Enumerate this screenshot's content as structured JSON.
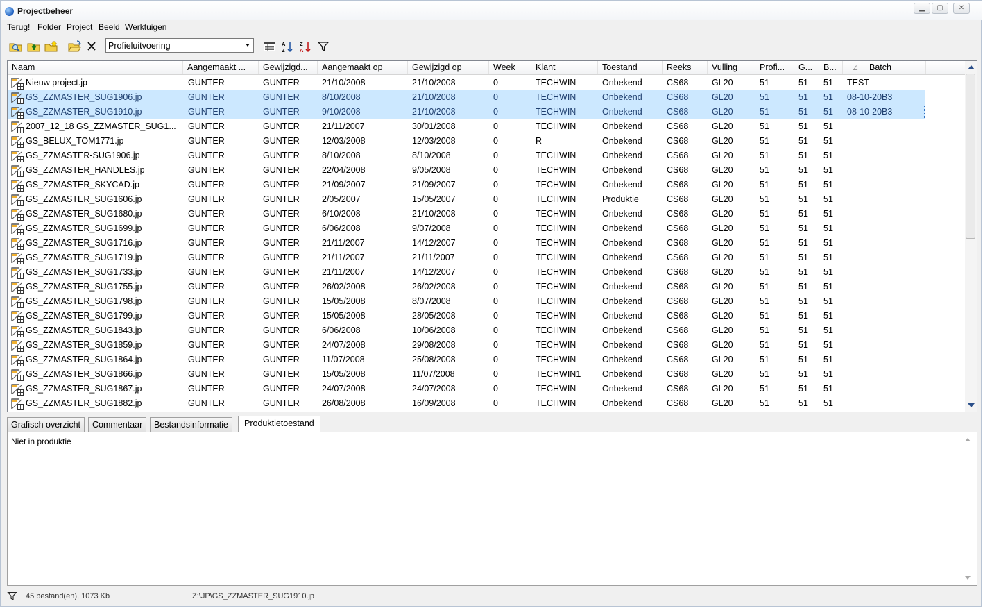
{
  "window": {
    "title": "Projectbeheer"
  },
  "menu": [
    "Terug!",
    "Folder",
    "Project",
    "Beeld",
    "Werktuigen"
  ],
  "toolbar": {
    "left_icons": [
      "search-folder-icon",
      "folder-up-icon",
      "new-folder-icon",
      "open-folder-icon",
      "delete-icon"
    ],
    "profile_select": {
      "value": "Profieluitvoering"
    },
    "right_icons": [
      "details-view-icon",
      "sort-ascending-icon",
      "sort-descending-icon",
      "filter-icon"
    ]
  },
  "columns": [
    "Naam",
    "Aangemaakt ...",
    "Gewijzigd...",
    "Aangemaakt op",
    "Gewijzigd op",
    "Week",
    "Klant",
    "Toestand",
    "Reeks",
    "Vulling",
    "Profi...",
    "G...",
    "B...",
    "Batch"
  ],
  "rows": [
    {
      "name": "Nieuw project.jp",
      "created_by": "GUNTER",
      "modified_by": "GUNTER",
      "created_on": "21/10/2008",
      "modified_on": "21/10/2008",
      "week": "0",
      "client": "TECHWIN",
      "state": "Onbekend",
      "series": "CS68",
      "filling": "GL20",
      "profile": "51",
      "g": "51",
      "b": "51",
      "batch": "TEST"
    },
    {
      "name": "GS_ZZMASTER_SUG1906.jp",
      "created_by": "GUNTER",
      "modified_by": "GUNTER",
      "created_on": "8/10/2008",
      "modified_on": "21/10/2008",
      "week": "0",
      "client": "TECHWIN",
      "state": "Onbekend",
      "series": "CS68",
      "filling": "GL20",
      "profile": "51",
      "g": "51",
      "b": "51",
      "batch": "08-10-20B3",
      "selected": true
    },
    {
      "name": "GS_ZZMASTER_SUG1910.jp",
      "created_by": "GUNTER",
      "modified_by": "GUNTER",
      "created_on": "9/10/2008",
      "modified_on": "21/10/2008",
      "week": "0",
      "client": "TECHWIN",
      "state": "Onbekend",
      "series": "CS68",
      "filling": "GL20",
      "profile": "51",
      "g": "51",
      "b": "51",
      "batch": "08-10-20B3",
      "selected": true,
      "focused": true
    },
    {
      "name": "2007_12_18 GS_ZZMASTER_SUG1...",
      "created_by": "GUNTER",
      "modified_by": "GUNTER",
      "created_on": "21/11/2007",
      "modified_on": "30/01/2008",
      "week": "0",
      "client": "TECHWIN",
      "state": "Onbekend",
      "series": "CS68",
      "filling": "GL20",
      "profile": "51",
      "g": "51",
      "b": "51",
      "batch": ""
    },
    {
      "name": "GS_BELUX_TOM1771.jp",
      "created_by": "GUNTER",
      "modified_by": "GUNTER",
      "created_on": "12/03/2008",
      "modified_on": "12/03/2008",
      "week": "0",
      "client": "R",
      "state": "Onbekend",
      "series": "CS68",
      "filling": "GL20",
      "profile": "51",
      "g": "51",
      "b": "51",
      "batch": ""
    },
    {
      "name": "GS_ZZMASTER-SUG1906.jp",
      "created_by": "GUNTER",
      "modified_by": "GUNTER",
      "created_on": "8/10/2008",
      "modified_on": "8/10/2008",
      "week": "0",
      "client": "TECHWIN",
      "state": "Onbekend",
      "series": "CS68",
      "filling": "GL20",
      "profile": "51",
      "g": "51",
      "b": "51",
      "batch": ""
    },
    {
      "name": "GS_ZZMASTER_HANDLES.jp",
      "created_by": "GUNTER",
      "modified_by": "GUNTER",
      "created_on": "22/04/2008",
      "modified_on": "9/05/2008",
      "week": "0",
      "client": "TECHWIN",
      "state": "Onbekend",
      "series": "CS68",
      "filling": "GL20",
      "profile": "51",
      "g": "51",
      "b": "51",
      "batch": ""
    },
    {
      "name": "GS_ZZMASTER_SKYCAD.jp",
      "created_by": "GUNTER",
      "modified_by": "GUNTER",
      "created_on": "21/09/2007",
      "modified_on": "21/09/2007",
      "week": "0",
      "client": "TECHWIN",
      "state": "Onbekend",
      "series": "CS68",
      "filling": "GL20",
      "profile": "51",
      "g": "51",
      "b": "51",
      "batch": ""
    },
    {
      "name": "GS_ZZMASTER_SUG1606.jp",
      "created_by": "GUNTER",
      "modified_by": "GUNTER",
      "created_on": "2/05/2007",
      "modified_on": "15/05/2007",
      "week": "0",
      "client": "TECHWIN",
      "state": "Produktie",
      "series": "CS68",
      "filling": "GL20",
      "profile": "51",
      "g": "51",
      "b": "51",
      "batch": ""
    },
    {
      "name": "GS_ZZMASTER_SUG1680.jp",
      "created_by": "GUNTER",
      "modified_by": "GUNTER",
      "created_on": "6/10/2008",
      "modified_on": "21/10/2008",
      "week": "0",
      "client": "TECHWIN",
      "state": "Onbekend",
      "series": "CS68",
      "filling": "GL20",
      "profile": "51",
      "g": "51",
      "b": "51",
      "batch": ""
    },
    {
      "name": "GS_ZZMASTER_SUG1699.jp",
      "created_by": "GUNTER",
      "modified_by": "GUNTER",
      "created_on": "6/06/2008",
      "modified_on": "9/07/2008",
      "week": "0",
      "client": "TECHWIN",
      "state": "Onbekend",
      "series": "CS68",
      "filling": "GL20",
      "profile": "51",
      "g": "51",
      "b": "51",
      "batch": ""
    },
    {
      "name": "GS_ZZMASTER_SUG1716.jp",
      "created_by": "GUNTER",
      "modified_by": "GUNTER",
      "created_on": "21/11/2007",
      "modified_on": "14/12/2007",
      "week": "0",
      "client": "TECHWIN",
      "state": "Onbekend",
      "series": "CS68",
      "filling": "GL20",
      "profile": "51",
      "g": "51",
      "b": "51",
      "batch": ""
    },
    {
      "name": "GS_ZZMASTER_SUG1719.jp",
      "created_by": "GUNTER",
      "modified_by": "GUNTER",
      "created_on": "21/11/2007",
      "modified_on": "21/11/2007",
      "week": "0",
      "client": "TECHWIN",
      "state": "Onbekend",
      "series": "CS68",
      "filling": "GL20",
      "profile": "51",
      "g": "51",
      "b": "51",
      "batch": ""
    },
    {
      "name": "GS_ZZMASTER_SUG1733.jp",
      "created_by": "GUNTER",
      "modified_by": "GUNTER",
      "created_on": "21/11/2007",
      "modified_on": "14/12/2007",
      "week": "0",
      "client": "TECHWIN",
      "state": "Onbekend",
      "series": "CS68",
      "filling": "GL20",
      "profile": "51",
      "g": "51",
      "b": "51",
      "batch": ""
    },
    {
      "name": "GS_ZZMASTER_SUG1755.jp",
      "created_by": "GUNTER",
      "modified_by": "GUNTER",
      "created_on": "26/02/2008",
      "modified_on": "26/02/2008",
      "week": "0",
      "client": "TECHWIN",
      "state": "Onbekend",
      "series": "CS68",
      "filling": "GL20",
      "profile": "51",
      "g": "51",
      "b": "51",
      "batch": ""
    },
    {
      "name": "GS_ZZMASTER_SUG1798.jp",
      "created_by": "GUNTER",
      "modified_by": "GUNTER",
      "created_on": "15/05/2008",
      "modified_on": "8/07/2008",
      "week": "0",
      "client": "TECHWIN",
      "state": "Onbekend",
      "series": "CS68",
      "filling": "GL20",
      "profile": "51",
      "g": "51",
      "b": "51",
      "batch": ""
    },
    {
      "name": "GS_ZZMASTER_SUG1799.jp",
      "created_by": "GUNTER",
      "modified_by": "GUNTER",
      "created_on": "15/05/2008",
      "modified_on": "28/05/2008",
      "week": "0",
      "client": "TECHWIN",
      "state": "Onbekend",
      "series": "CS68",
      "filling": "GL20",
      "profile": "51",
      "g": "51",
      "b": "51",
      "batch": ""
    },
    {
      "name": "GS_ZZMASTER_SUG1843.jp",
      "created_by": "GUNTER",
      "modified_by": "GUNTER",
      "created_on": "6/06/2008",
      "modified_on": "10/06/2008",
      "week": "0",
      "client": "TECHWIN",
      "state": "Onbekend",
      "series": "CS68",
      "filling": "GL20",
      "profile": "51",
      "g": "51",
      "b": "51",
      "batch": ""
    },
    {
      "name": "GS_ZZMASTER_SUG1859.jp",
      "created_by": "GUNTER",
      "modified_by": "GUNTER",
      "created_on": "24/07/2008",
      "modified_on": "29/08/2008",
      "week": "0",
      "client": "TECHWIN",
      "state": "Onbekend",
      "series": "CS68",
      "filling": "GL20",
      "profile": "51",
      "g": "51",
      "b": "51",
      "batch": ""
    },
    {
      "name": "GS_ZZMASTER_SUG1864.jp",
      "created_by": "GUNTER",
      "modified_by": "GUNTER",
      "created_on": "11/07/2008",
      "modified_on": "25/08/2008",
      "week": "0",
      "client": "TECHWIN",
      "state": "Onbekend",
      "series": "CS68",
      "filling": "GL20",
      "profile": "51",
      "g": "51",
      "b": "51",
      "batch": ""
    },
    {
      "name": "GS_ZZMASTER_SUG1866.jp",
      "created_by": "GUNTER",
      "modified_by": "GUNTER",
      "created_on": "15/05/2008",
      "modified_on": "11/07/2008",
      "week": "0",
      "client": "TECHWIN1",
      "state": "Onbekend",
      "series": "CS68",
      "filling": "GL20",
      "profile": "51",
      "g": "51",
      "b": "51",
      "batch": ""
    },
    {
      "name": "GS_ZZMASTER_SUG1867.jp",
      "created_by": "GUNTER",
      "modified_by": "GUNTER",
      "created_on": "24/07/2008",
      "modified_on": "24/07/2008",
      "week": "0",
      "client": "TECHWIN",
      "state": "Onbekend",
      "series": "CS68",
      "filling": "GL20",
      "profile": "51",
      "g": "51",
      "b": "51",
      "batch": ""
    },
    {
      "name": "GS_ZZMASTER_SUG1882.jp",
      "created_by": "GUNTER",
      "modified_by": "GUNTER",
      "created_on": "26/08/2008",
      "modified_on": "16/09/2008",
      "week": "0",
      "client": "TECHWIN",
      "state": "Onbekend",
      "series": "CS68",
      "filling": "GL20",
      "profile": "51",
      "g": "51",
      "b": "51",
      "batch": ""
    }
  ],
  "tabs": [
    {
      "label": "Grafisch overzicht"
    },
    {
      "label": "Commentaar"
    },
    {
      "label": "Bestandsinformatie"
    },
    {
      "label": "Produktietoestand",
      "active": true
    }
  ],
  "tab_panel": {
    "text": "Niet in produktie"
  },
  "status": {
    "count": "45 bestand(en), 1073 Kb",
    "path": "Z:\\JP\\GS_ZZMASTER_SUG1910.jp"
  },
  "colors": {
    "selection": "#cce8ff",
    "window_bg": "#f0f0f0",
    "accent": "#1f5fbf"
  }
}
